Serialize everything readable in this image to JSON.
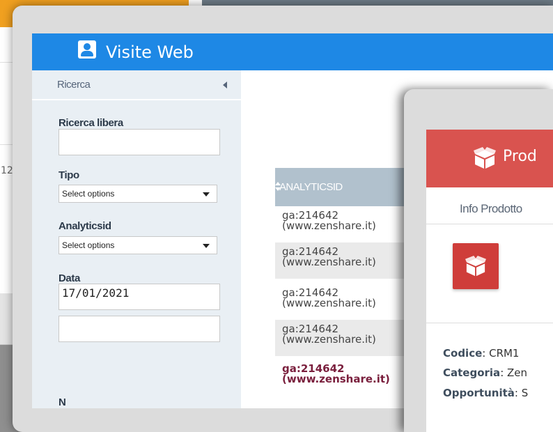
{
  "background_window": {
    "partial_number": "12"
  },
  "main_window": {
    "title": "Visite Web",
    "colors": {
      "header": "#1e88e5",
      "sidebar": "#e9eff4",
      "table_header": "#b1c1cd"
    },
    "sidebar": {
      "heading": "Ricerca",
      "free_search_label": "Ricerca libera",
      "free_search_value": "",
      "type_label": "Tipo",
      "type_select": "Select options",
      "analyticsid_label": "Analyticsid",
      "analyticsid_select": "Select options",
      "date_label": "Data",
      "date_from": "17/01/2021",
      "date_to": "",
      "cut_label": "N"
    },
    "table": {
      "header": "ANALYTICSID",
      "rows": [
        {
          "line1": "ga:214642",
          "line2": "(www.zenshare.it)"
        },
        {
          "line1": "ga:214642",
          "line2": "(www.zenshare.it)"
        },
        {
          "line1": "ga:214642",
          "line2": "(www.zenshare.it)"
        },
        {
          "line1": "ga:214642",
          "line2": "(www.zenshare.it)"
        },
        {
          "line1": "ga:214642",
          "line2": "(www.zenshare.it)"
        }
      ]
    }
  },
  "product_window": {
    "title": "Prod",
    "header_color": "#d9534f",
    "tab": "Info Prodotto",
    "fields": [
      {
        "key": "Codice",
        "value": "CRM1"
      },
      {
        "key": "Categoria",
        "value": "Zen"
      },
      {
        "key": "Opportunità",
        "value": "S"
      }
    ]
  }
}
